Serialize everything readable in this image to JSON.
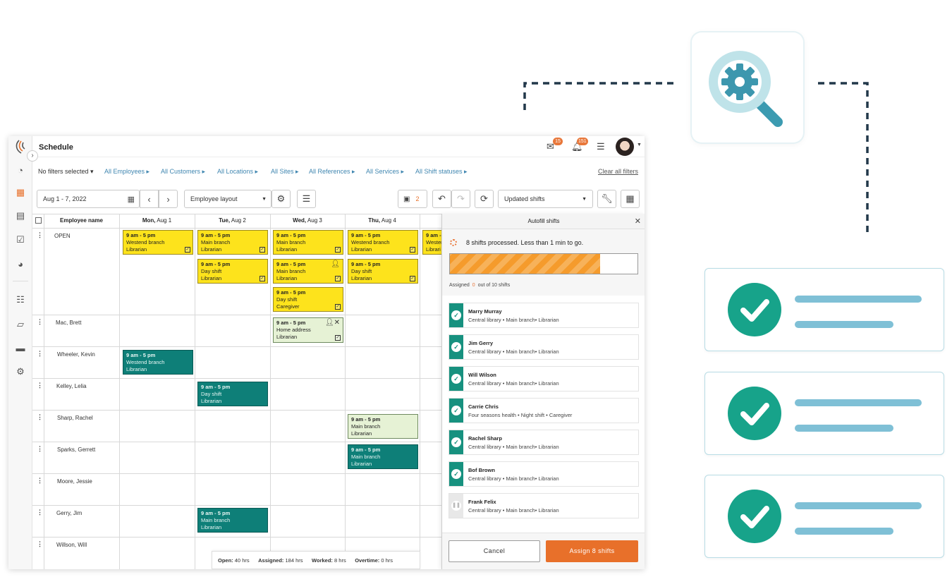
{
  "app": {
    "title": "Schedule",
    "messages_count": "15",
    "notifications_count": "151"
  },
  "filters": {
    "no_filters": "No filters selected",
    "items": [
      "All Employees",
      "All Customers",
      "All Locations",
      "All Sites",
      "All References",
      "All Services",
      "All Shift statuses"
    ],
    "clear_all": "Clear all filters"
  },
  "toolbar": {
    "date_range": "Aug 1 - 7, 2022",
    "layout": "Employee layout",
    "saved_count": "2",
    "view_select": "Updated shifts"
  },
  "grid": {
    "employee_header": "Employee name",
    "days": [
      {
        "dow": "Mon,",
        "date": "Aug 1"
      },
      {
        "dow": "Tue,",
        "date": "Aug 2"
      },
      {
        "dow": "Wed,",
        "date": "Aug 3"
      },
      {
        "dow": "Thu,",
        "date": "Aug 4"
      }
    ],
    "rows": [
      "OPEN",
      "Mac, Brett",
      "Wheeler, Kevin",
      "Kelley, Lelia",
      "Sharp, Rachel",
      "Sparks, Gerrett",
      "Moore, Jessie",
      "Gerry, Jim",
      "Willson, Will"
    ],
    "shifts": [
      {
        "time": "9 am - 5 pm",
        "site": "Westend branch",
        "role": "Librarian",
        "color": "#fde31c"
      },
      {
        "time": "9 am - 5 pm",
        "site": "Main branch",
        "role": "Librarian",
        "color": "#fde31c"
      },
      {
        "time": "9 am - 5 pm",
        "site": "Main branch",
        "role": "Librarian",
        "color": "#fde31c"
      },
      {
        "time": "9 am - 5 pm",
        "site": "Westend branch",
        "role": "Librarian",
        "color": "#fde31c"
      },
      {
        "time": "9 am -",
        "site": "Westen",
        "role": "Librari",
        "color": "#fde31c"
      },
      {
        "time": "9 am - 5 pm",
        "site": "Day shift",
        "role": "Librarian",
        "color": "#fde31c"
      },
      {
        "time": "9 am - 5 pm",
        "site": "Main branch",
        "role": "Librarian",
        "color": "#fde31c"
      },
      {
        "time": "9 am - 5 pm",
        "site": "Day shift",
        "role": "Librarian",
        "color": "#fde31c"
      },
      {
        "time": "9 am - 5 pm",
        "site": "Day shift",
        "role": "Caregiver",
        "color": "#fde31c"
      },
      {
        "time": "9 am - 5 pm",
        "site": "Home address",
        "role": "Librarian",
        "color": "#e6f2d5"
      },
      {
        "time": "9 am - 5 pm",
        "site": "Westend branch",
        "role": "Librarian",
        "color": "#0e7f78"
      },
      {
        "time": "9 am - 5 pm",
        "site": "Day shift",
        "role": "Librarian",
        "color": "#0e7f78"
      },
      {
        "time": "9 am - 5 pm",
        "site": "Main branch",
        "role": "Librarian",
        "color": "#e6f2d5"
      },
      {
        "time": "9 am - 5 pm",
        "site": "Main branch",
        "role": "Librarian",
        "color": "#0e7f78"
      },
      {
        "time": "9 am - 5 pm",
        "site": "Main branch",
        "role": "Librarian",
        "color": "#0e7f78"
      }
    ],
    "totals": {
      "open_label": "Open:",
      "open_value": "40 hrs",
      "assigned_label": "Assigned:",
      "assigned_value": "184 hrs",
      "worked_label": "Worked:",
      "worked_value": "8 hrs",
      "overtime_label": "Overtime:",
      "overtime_value": "0 hrs"
    }
  },
  "autofill": {
    "title": "Autofill shifts",
    "status": "8 shifts processed. Less than 1 min to go.",
    "progress": 0.8,
    "assigned_label": "Assigned",
    "assigned_count": "0",
    "assigned_suffix": "out of 10 shifts",
    "employees": [
      {
        "name": "Marry Murray",
        "detail": "Central library • Main branch• Librarian",
        "done": true
      },
      {
        "name": "Jim Gerry",
        "detail": "Central library • Main branch• Librarian",
        "done": true
      },
      {
        "name": "Will Wilson",
        "detail": "Central library • Main branch• Librarian",
        "done": true
      },
      {
        "name": "Carrie Chris",
        "detail": "Four seasons health • Night shift • Caregiver",
        "done": true
      },
      {
        "name": "Rachel Sharp",
        "detail": "Central library • Main branch• Librarian",
        "done": true
      },
      {
        "name": "Bof Brown",
        "detail": "Central library • Main branch• Librarian",
        "done": true
      },
      {
        "name": "Frank Felix",
        "detail": "Central library • Main branch• Librarian",
        "done": false
      }
    ],
    "cancel_label": "Cancel",
    "assign_label": "Assign 8 shifts"
  },
  "colors": {
    "accent_orange": "#e8702a",
    "teal": "#0e7f78",
    "yellow": "#fde31c",
    "check_green": "#17a38a"
  }
}
